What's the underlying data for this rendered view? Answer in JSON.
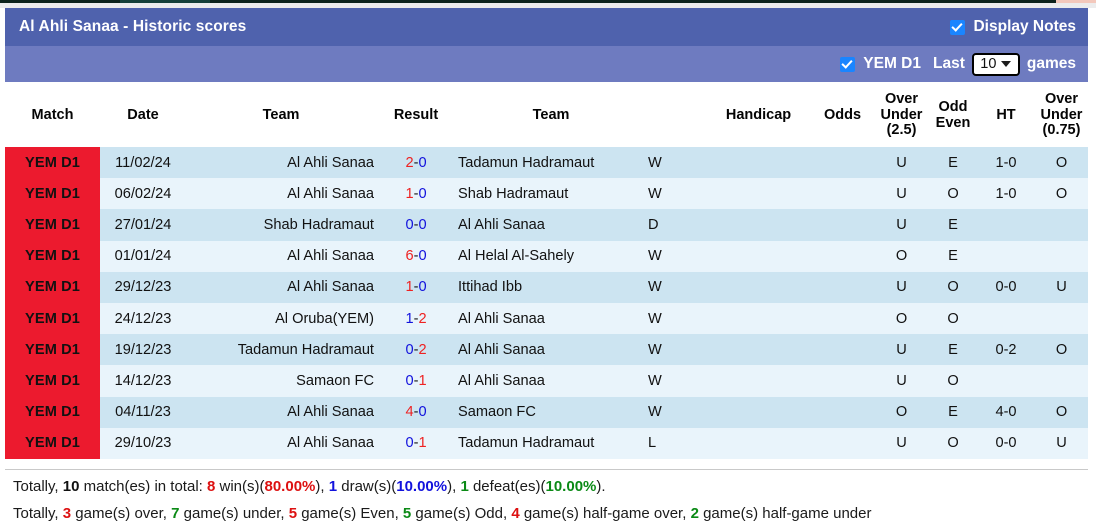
{
  "header": {
    "title": "Al Ahli Sanaa - Historic scores",
    "display_notes_label": "Display Notes",
    "league_filter_label": "YEM D1",
    "last_label": "Last",
    "games_label": "games",
    "games_count": "10",
    "accent_bar_1": "#4f62ad",
    "accent_bar_2": "#6e7bc0",
    "checkbox_color": "#1a85ff"
  },
  "table": {
    "columns": [
      {
        "key": "match",
        "label": "Match"
      },
      {
        "key": "date",
        "label": "Date"
      },
      {
        "key": "home",
        "label": "Team"
      },
      {
        "key": "score",
        "label": "Result"
      },
      {
        "key": "away",
        "label": "Team"
      },
      {
        "key": "wdl",
        "label": ""
      },
      {
        "key": "hcp",
        "label": "Handicap"
      },
      {
        "key": "odds",
        "label": "Odds"
      },
      {
        "key": "ou",
        "label": "Over Under (2.5)",
        "line1": "Over",
        "line2": "Under",
        "line3": "(2.5)"
      },
      {
        "key": "oe",
        "label": "Odd Even",
        "line1": "Odd",
        "line2": "Even"
      },
      {
        "key": "ht",
        "label": "HT"
      },
      {
        "key": "ou075",
        "label": "Over Under (0.75)",
        "line1": "Over",
        "line2": "Under",
        "line3": "(0.75)"
      }
    ],
    "rows": [
      {
        "match": "YEM D1",
        "date": "11/02/24",
        "home": "Al Ahli Sanaa",
        "home_color": "red",
        "score_home": "2",
        "score_home_color": "red",
        "score_away": "0",
        "score_away_color": "blue",
        "away": "Tadamun Hadramaut",
        "away_color": "dark",
        "wdl": "W",
        "wdl_color": "red",
        "hcp": "",
        "odds": "",
        "ou": "U",
        "ou_color": "green",
        "oe": "E",
        "oe_color": "red",
        "ht": "1-0",
        "ou075": "O",
        "ou075_color": "red"
      },
      {
        "match": "YEM D1",
        "date": "06/02/24",
        "home": "Al Ahli Sanaa",
        "home_color": "red",
        "score_home": "1",
        "score_home_color": "red",
        "score_away": "0",
        "score_away_color": "blue",
        "away": "Shab Hadramaut",
        "away_color": "dark",
        "wdl": "W",
        "wdl_color": "red",
        "hcp": "",
        "odds": "",
        "ou": "U",
        "ou_color": "green",
        "oe": "O",
        "oe_color": "green",
        "ht": "1-0",
        "ou075": "O",
        "ou075_color": "red"
      },
      {
        "match": "YEM D1",
        "date": "27/01/24",
        "home": "Shab Hadramaut",
        "home_color": "dark",
        "score_home": "0",
        "score_home_color": "blue",
        "score_away": "0",
        "score_away_color": "blue",
        "away": "Al Ahli Sanaa",
        "away_color": "blue",
        "wdl": "D",
        "wdl_color": "blue",
        "hcp": "",
        "odds": "",
        "ou": "U",
        "ou_color": "green",
        "oe": "E",
        "oe_color": "red",
        "ht": "",
        "ou075": "",
        "ou075_color": "red"
      },
      {
        "match": "YEM D1",
        "date": "01/01/24",
        "home": "Al Ahli Sanaa",
        "home_color": "red",
        "score_home": "6",
        "score_home_color": "red",
        "score_away": "0",
        "score_away_color": "blue",
        "away": "Al Helal Al-Sahely",
        "away_color": "dark",
        "wdl": "W",
        "wdl_color": "red",
        "hcp": "",
        "odds": "",
        "ou": "O",
        "ou_color": "red",
        "oe": "E",
        "oe_color": "red",
        "ht": "",
        "ou075": "",
        "ou075_color": "red"
      },
      {
        "match": "YEM D1",
        "date": "29/12/23",
        "home": "Al Ahli Sanaa",
        "home_color": "red",
        "score_home": "1",
        "score_home_color": "red",
        "score_away": "0",
        "score_away_color": "blue",
        "away": "Ittihad Ibb",
        "away_color": "dark",
        "wdl": "W",
        "wdl_color": "red",
        "hcp": "",
        "odds": "",
        "ou": "U",
        "ou_color": "green",
        "oe": "O",
        "oe_color": "green",
        "ht": "0-0",
        "ou075": "U",
        "ou075_color": "green"
      },
      {
        "match": "YEM D1",
        "date": "24/12/23",
        "home": "Al Oruba(YEM)",
        "home_color": "dark",
        "score_home": "1",
        "score_home_color": "blue",
        "score_away": "2",
        "score_away_color": "red",
        "away": "Al Ahli Sanaa",
        "away_color": "red",
        "wdl": "W",
        "wdl_color": "red",
        "hcp": "",
        "odds": "",
        "ou": "O",
        "ou_color": "red",
        "oe": "O",
        "oe_color": "green",
        "ht": "",
        "ou075": "",
        "ou075_color": "red"
      },
      {
        "match": "YEM D1",
        "date": "19/12/23",
        "home": "Tadamun Hadramaut",
        "home_color": "dark",
        "score_home": "0",
        "score_home_color": "blue",
        "score_away": "2",
        "score_away_color": "red",
        "away": "Al Ahli Sanaa",
        "away_color": "red",
        "wdl": "W",
        "wdl_color": "red",
        "hcp": "",
        "odds": "",
        "ou": "U",
        "ou_color": "green",
        "oe": "E",
        "oe_color": "red",
        "ht": "0-2",
        "ou075": "O",
        "ou075_color": "red"
      },
      {
        "match": "YEM D1",
        "date": "14/12/23",
        "home": "Samaon FC",
        "home_color": "dark",
        "score_home": "0",
        "score_home_color": "blue",
        "score_away": "1",
        "score_away_color": "red",
        "away": "Al Ahli Sanaa",
        "away_color": "red",
        "wdl": "W",
        "wdl_color": "red",
        "hcp": "",
        "odds": "",
        "ou": "U",
        "ou_color": "green",
        "oe": "O",
        "oe_color": "green",
        "ht": "",
        "ou075": "",
        "ou075_color": "red"
      },
      {
        "match": "YEM D1",
        "date": "04/11/23",
        "home": "Al Ahli Sanaa",
        "home_color": "red",
        "score_home": "4",
        "score_home_color": "red",
        "score_away": "0",
        "score_away_color": "blue",
        "away": "Samaon FC",
        "away_color": "dark",
        "wdl": "W",
        "wdl_color": "red",
        "hcp": "",
        "odds": "",
        "ou": "O",
        "ou_color": "red",
        "oe": "E",
        "oe_color": "red",
        "ht": "4-0",
        "ou075": "O",
        "ou075_color": "red"
      },
      {
        "match": "YEM D1",
        "date": "29/10/23",
        "home": "Al Ahli Sanaa",
        "home_color": "green",
        "score_home": "0",
        "score_home_color": "blue",
        "score_away": "1",
        "score_away_color": "red",
        "away": "Tadamun Hadramaut",
        "away_color": "dark",
        "wdl": "L",
        "wdl_color": "green",
        "hcp": "",
        "odds": "",
        "ou": "U",
        "ou_color": "green",
        "oe": "O",
        "oe_color": "green",
        "ht": "0-0",
        "ou075": "U",
        "ou075_color": "green"
      }
    ]
  },
  "footer": {
    "line1": {
      "pre": "Totally, ",
      "total": "10",
      "mid1": " match(es) in total: ",
      "wins": "8",
      "mid2": " win(s)(",
      "win_pct": "80.00%",
      "mid3": "), ",
      "draws": "1",
      "mid4": " draw(s)(",
      "draw_pct": "10.00%",
      "mid5": "), ",
      "defeats": "1",
      "mid6": " defeat(es)(",
      "defeat_pct": "10.00%",
      "end": ")."
    },
    "line2": {
      "pre": "Totally, ",
      "over": "3",
      "mid1": " game(s) over, ",
      "under": "7",
      "mid2": " game(s) under, ",
      "even": "5",
      "mid3": " game(s) Even, ",
      "odd": "5",
      "mid4": " game(s) Odd, ",
      "half_over": "4",
      "mid5": " game(s) half-game over, ",
      "half_under": "2",
      "end": " game(s) half-game under"
    }
  }
}
